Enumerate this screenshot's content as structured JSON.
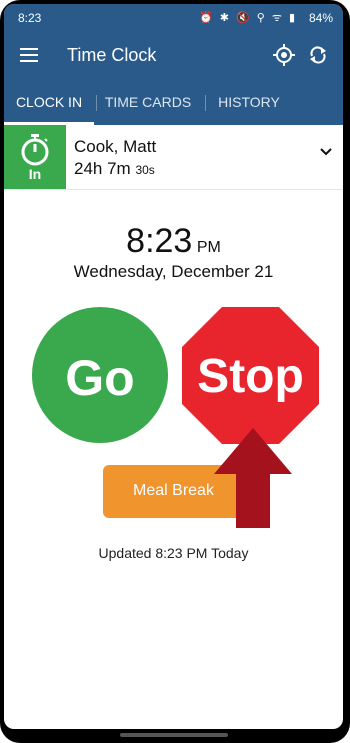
{
  "status": {
    "time": "8:23",
    "battery": "84%",
    "icons": "⏰ ✱ 🔇 ⚲ ᯤ ▮"
  },
  "appbar": {
    "title": "Time Clock"
  },
  "tabs": [
    {
      "label": "CLOCK IN",
      "active": true
    },
    {
      "label": "TIME CARDS",
      "active": false
    },
    {
      "label": "HISTORY",
      "active": false
    }
  ],
  "employee": {
    "status_label": "In",
    "name": "Cook, Matt",
    "hours_main": "24h 7m",
    "hours_seconds": "30s"
  },
  "clock": {
    "time": "8:23",
    "ampm": "PM",
    "date": "Wednesday, December 21"
  },
  "actions": {
    "go_label": "Go",
    "stop_label": "Stop",
    "meal_label": "Meal Break"
  },
  "footer": {
    "updated": "Updated 8:23 PM Today"
  },
  "colors": {
    "primary": "#2a5a8a",
    "go": "#3aa94d",
    "stop": "#e8242c",
    "meal": "#f0952e",
    "arrow": "#a3121d"
  }
}
